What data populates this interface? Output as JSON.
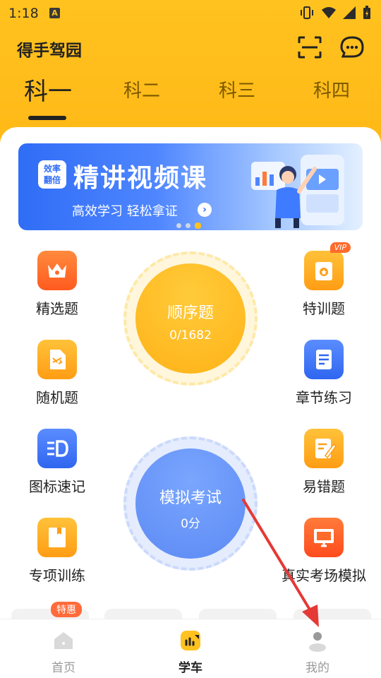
{
  "status": {
    "time": "1:18",
    "notif": "A"
  },
  "header": {
    "title": "得手驾园"
  },
  "tabs": [
    "科一",
    "科二",
    "科三",
    "科四"
  ],
  "banner": {
    "badge_line1": "效率",
    "badge_line2": "翻倍",
    "headline": "精讲视频课",
    "sub": "高效学习  轻松拿证"
  },
  "left_features": [
    "精选题",
    "随机题",
    "图标速记",
    "专项训练"
  ],
  "right_features": [
    "特训题",
    "章节练习",
    "易错题",
    "真实考场模拟"
  ],
  "vip_badge": "VIP",
  "sequential": {
    "label": "顺序题",
    "progress": "0/1682"
  },
  "mock_exam": {
    "label": "模拟考试",
    "score": "0分"
  },
  "promo_badge": "特惠",
  "nav": [
    "首页",
    "学车",
    "我的"
  ],
  "colors": {
    "brand": "#ffc21f",
    "accent_blue": "#5c8af3",
    "pointer": "#e53935"
  }
}
